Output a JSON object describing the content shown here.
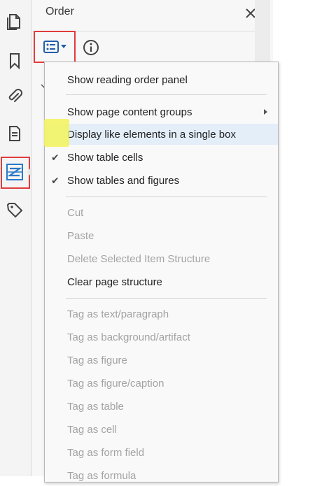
{
  "panel": {
    "title": "Order"
  },
  "menu": {
    "items": [
      {
        "label": "Show reading order panel",
        "enabled": true,
        "checked": false,
        "submenu": false
      },
      {
        "label": "Show page content groups",
        "enabled": true,
        "checked": false,
        "submenu": true
      },
      {
        "label": "Display like elements in a single box",
        "enabled": true,
        "checked": false,
        "submenu": false,
        "highlighted": true
      },
      {
        "label": "Show table cells",
        "enabled": true,
        "checked": true,
        "submenu": false
      },
      {
        "label": "Show tables and figures",
        "enabled": true,
        "checked": true,
        "submenu": false
      },
      {
        "label": "Cut",
        "enabled": false
      },
      {
        "label": "Paste",
        "enabled": false
      },
      {
        "label": "Delete Selected Item Structure",
        "enabled": false
      },
      {
        "label": "Clear page structure",
        "enabled": true
      },
      {
        "label": "Tag as text/paragraph",
        "enabled": false
      },
      {
        "label": "Tag as background/artifact",
        "enabled": false
      },
      {
        "label": "Tag as figure",
        "enabled": false
      },
      {
        "label": "Tag as figure/caption",
        "enabled": false
      },
      {
        "label": "Tag as table",
        "enabled": false
      },
      {
        "label": "Tag as cell",
        "enabled": false
      },
      {
        "label": "Tag as form field",
        "enabled": false
      },
      {
        "label": "Tag as formula",
        "enabled": false
      }
    ],
    "check_glyph": "✔"
  },
  "rail": {
    "icons": [
      "pages-icon",
      "bookmark-icon",
      "attachment-icon",
      "document-properties-icon",
      "reading-order-icon",
      "tags-icon"
    ],
    "active": "reading-order-icon"
  },
  "colors": {
    "accent": "#2a78c8",
    "highlight_box": "#e03c3c",
    "yellow_marker": "#f3f35a",
    "hover_row": "#e4eef9"
  }
}
